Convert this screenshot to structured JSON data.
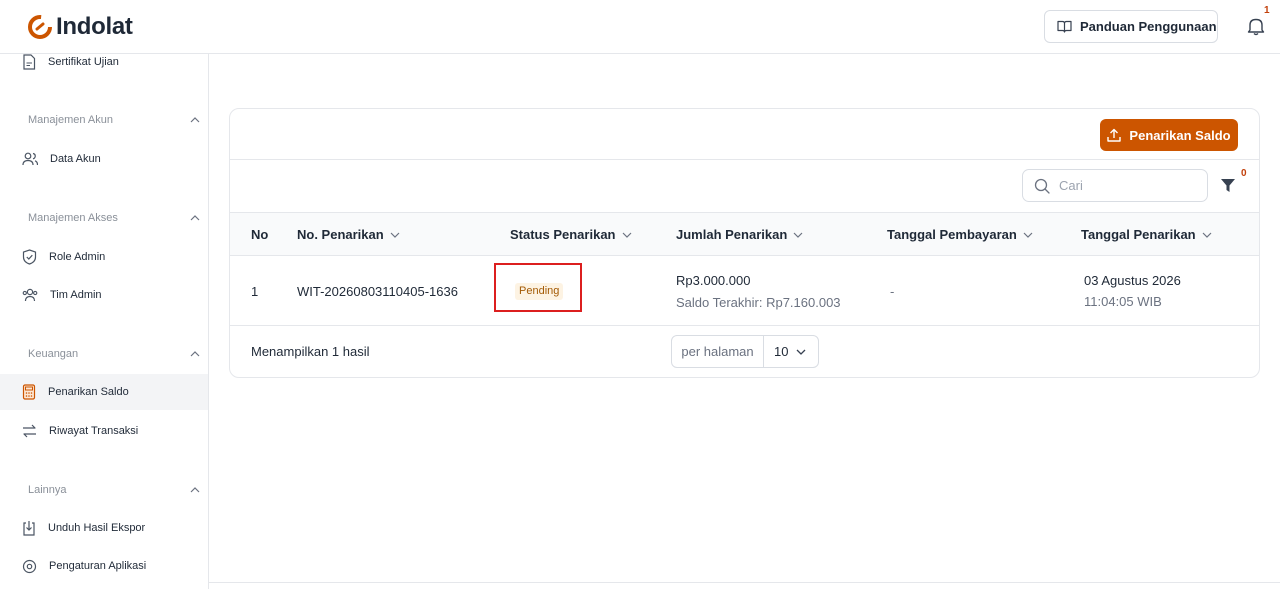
{
  "app": {
    "brand_name": "Indolat",
    "brand_color": "#cc5500"
  },
  "header": {
    "guide_label": "Panduan Penggunaan",
    "notification_count": "1"
  },
  "sidebar": {
    "top_item": "Sertifikat Ujian",
    "sections": [
      {
        "title": "Manajemen Akun",
        "items": [
          "Data Akun"
        ]
      },
      {
        "title": "Manajemen Akses",
        "items": [
          "Role Admin",
          "Tim Admin"
        ]
      },
      {
        "title": "Keuangan",
        "items": [
          "Penarikan Saldo",
          "Riwayat Transaksi"
        ]
      },
      {
        "title": "Lainnya",
        "items": [
          "Unduh Hasil Ekspor",
          "Pengaturan Aplikasi"
        ]
      }
    ],
    "active_item": "Penarikan Saldo"
  },
  "main": {
    "primary_button": "Penarikan Saldo",
    "search_placeholder": "Cari",
    "filter_count": "0",
    "columns": [
      "No",
      "No. Penarikan",
      "Status Penarikan",
      "Jumlah Penarikan",
      "Tanggal Pembayaran",
      "Tanggal Penarikan"
    ],
    "rows": [
      {
        "no": "1",
        "withdrawal_no": "WIT-20260803110405-1636",
        "status": "Pending",
        "amount": "Rp3.000.000",
        "last_balance": "Saldo Terakhir: Rp7.160.003",
        "payment_date": "-",
        "withdraw_date": "03 Agustus 2026",
        "withdraw_time": "11:04:05 WIB"
      }
    ],
    "result_text": "Menampilkan 1 hasil",
    "per_page_label": "per halaman",
    "per_page_value": "10"
  }
}
